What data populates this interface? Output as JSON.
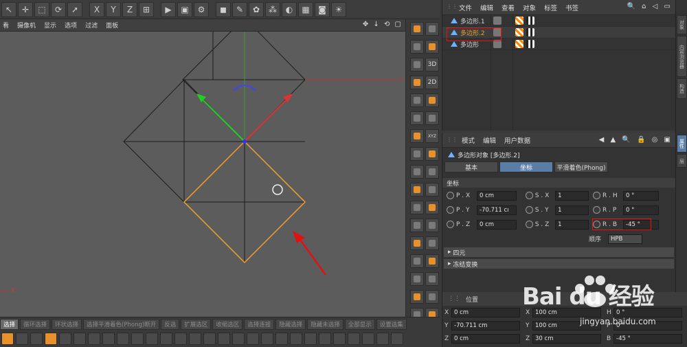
{
  "colors": {
    "accent_blue": "#5a7da6",
    "selection_orange": "#f0a030",
    "annotation_red": "#e11111",
    "viewport_bg": "#5c5c5c"
  },
  "toolbar": {
    "icons": [
      "select-arrow-icon",
      "move-icon",
      "scale-icon",
      "rotate-icon",
      "cursor-icon",
      "x-axis-icon",
      "y-axis-icon",
      "z-axis-icon",
      "world-coords-icon",
      "render-view-icon",
      "render-picture-icon",
      "render-settings-icon",
      "cube-icon",
      "pen-icon",
      "subdivision-icon",
      "array-icon",
      "deformer-icon",
      "floor-icon",
      "camera-icon",
      "light-icon"
    ],
    "x_label": "X",
    "y_label": "Y",
    "z_label": "Z"
  },
  "viewport": {
    "menu": [
      "看",
      "摄像机",
      "显示",
      "选项",
      "过滤",
      "面板"
    ],
    "nav_icons": "✥ ↓ ⟲ ▢",
    "axis_label": "X"
  },
  "tools_col": {
    "label_3d": "3D",
    "label_2d": "2D",
    "label_xyz": "XYZ"
  },
  "mode_bar": {
    "items": [
      "选择",
      "循环选择",
      "环状选择",
      "选择平滑着色(Phong)断开",
      "反选",
      "扩展选区",
      "收缩选区",
      "选择连接",
      "隐藏选择",
      "隐藏未选择",
      "全部显示",
      "设置选集"
    ]
  },
  "object_manager": {
    "menu": [
      "文件",
      "编辑",
      "查看",
      "对象",
      "标签",
      "书签"
    ],
    "tools": "🔍 ⌂ ◁ ▭",
    "objects": [
      {
        "name": "多边形.1"
      },
      {
        "name": "多边形.2"
      },
      {
        "name": "多边形"
      }
    ]
  },
  "attribute_manager": {
    "menu": [
      "模式",
      "编辑",
      "用户数据"
    ],
    "title": "多边形对象 [多边形.2]",
    "tabs": [
      "基本",
      "坐标",
      "平滑着色(Phong)"
    ],
    "active_tab": "坐标",
    "section": "坐标",
    "position": {
      "label_x": "P . X",
      "label_y": "P . Y",
      "label_z": "P . Z",
      "x": "0 cm",
      "y": "-70.711 cı",
      "z": "0 cm"
    },
    "scale": {
      "label_x": "S . X",
      "label_y": "S . Y",
      "label_z": "S . Z",
      "x": "1",
      "y": "1",
      "z": "1"
    },
    "rotation": {
      "label_h": "R . H",
      "label_p": "R . P",
      "label_b": "R . B",
      "h": "0 °",
      "p": "0 °",
      "b": "-45 °"
    },
    "order_label": "顺序",
    "order_value": "HPB",
    "collapsed": [
      "四元",
      "冻结变换"
    ]
  },
  "coordinates_manager": {
    "header": "位置",
    "rows": [
      {
        "a_label": "X",
        "a": "0 cm",
        "b_label": "X",
        "b": "100 cm",
        "c_label": "H",
        "c": "0 °"
      },
      {
        "a_label": "Y",
        "a": "-70.711 cm",
        "b_label": "Y",
        "b": "100 cm",
        "c_label": "P",
        "c": "0 °"
      },
      {
        "a_label": "Z",
        "a": "0 cm",
        "b_label": "Z",
        "b": "30 cm",
        "c_label": "B",
        "c": "-45 °"
      }
    ]
  },
  "side_tabs": [
    "对象",
    "内容浏览器",
    "构造",
    "属性",
    "层"
  ],
  "watermark": {
    "main": "Bai du 经验",
    "sub": "jingyan.baidu.com"
  }
}
